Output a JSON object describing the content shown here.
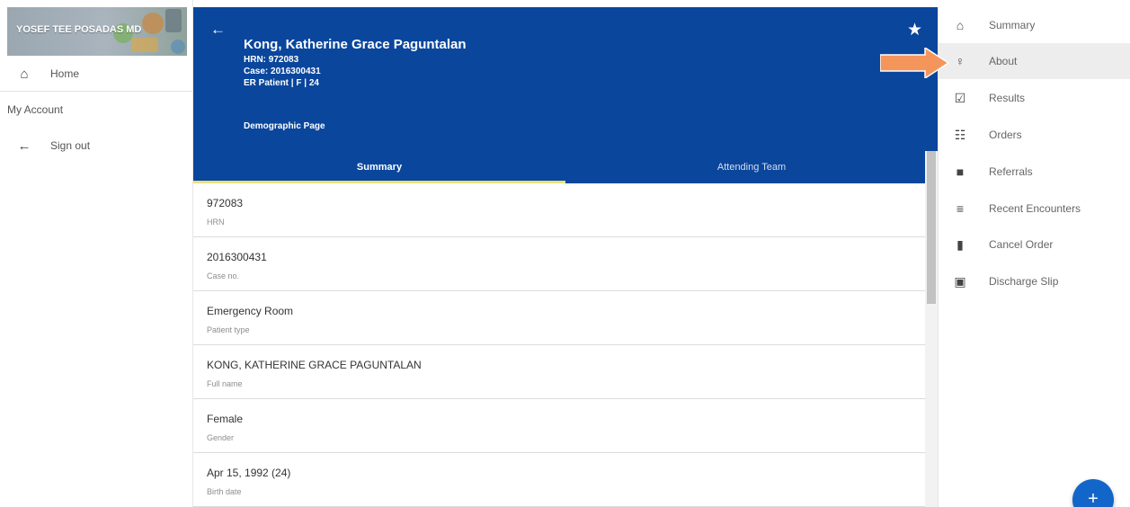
{
  "drawer": {
    "user_name": "YOSEF TEE POSADAS MD",
    "items": [
      {
        "label": "Home",
        "icon": "home-icon",
        "glyph": "⌂"
      },
      {
        "label": "My Account"
      },
      {
        "label": "Sign out",
        "icon": "arrow-left-icon",
        "glyph": "←"
      }
    ]
  },
  "header": {
    "patient_name": "Kong, Katherine Grace Paguntalan",
    "hrn_line": "HRN: 972083",
    "case_line": "Case: 2016300431",
    "type_line": "ER Patient | F | 24",
    "page_label": "Demographic Page",
    "back_glyph": "←",
    "star_glyph": "★"
  },
  "tabs": [
    {
      "label": "Summary",
      "active": true
    },
    {
      "label": "Attending Team",
      "active": false
    }
  ],
  "fields": [
    {
      "value": "972083",
      "label": "HRN"
    },
    {
      "value": "2016300431",
      "label": "Case no."
    },
    {
      "value": "Emergency Room",
      "label": "Patient type"
    },
    {
      "value": "KONG, KATHERINE GRACE PAGUNTALAN",
      "label": "Full name"
    },
    {
      "value": "Female",
      "label": "Gender"
    },
    {
      "value": "Apr 15, 1992 (24)",
      "label": "Birth date"
    }
  ],
  "right_menu": {
    "selected": "About",
    "items": [
      {
        "label": "Summary",
        "icon": "home-icon",
        "glyph": "⌂"
      },
      {
        "label": "About",
        "icon": "person-icon",
        "glyph": "♀"
      },
      {
        "label": "Results",
        "icon": "check-clipboard-icon",
        "glyph": "☑"
      },
      {
        "label": "Orders",
        "icon": "clipboard-icon",
        "glyph": "☷"
      },
      {
        "label": "Referrals",
        "icon": "bookmark-icon",
        "glyph": "■"
      },
      {
        "label": "Recent Encounters",
        "icon": "sort-icon",
        "glyph": "≡"
      },
      {
        "label": "Cancel Order",
        "icon": "trash-icon",
        "glyph": "▮"
      },
      {
        "label": "Discharge Slip",
        "icon": "badge-icon",
        "glyph": "▣"
      }
    ]
  },
  "fab": {
    "glyph": "+"
  },
  "colors": {
    "header": "#0a469c",
    "tab_underline": "#e7e27a",
    "fab": "#1366c9",
    "annotation_arrow": "#f4955c"
  }
}
